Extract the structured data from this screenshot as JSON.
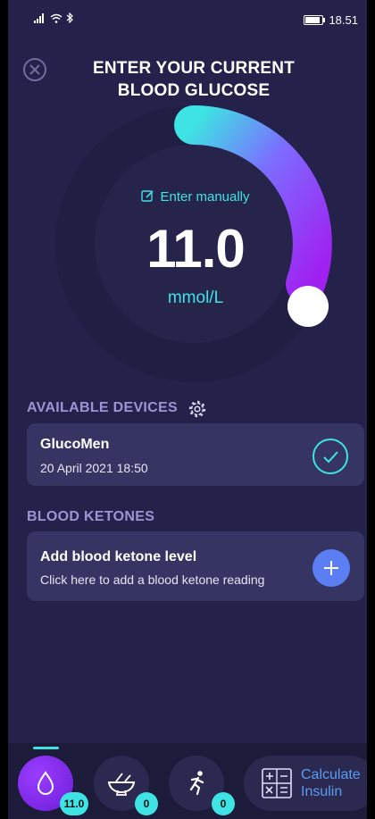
{
  "status_bar": {
    "time": "18.51"
  },
  "header": {
    "title_line1": "ENTER YOUR CURRENT",
    "title_line2": "BLOOD GLUCOSE"
  },
  "gauge": {
    "enter_manually_label": "Enter manually",
    "value": "11.0",
    "unit": "mmol/L"
  },
  "devices": {
    "section_label": "AVAILABLE DEVICES",
    "items": [
      {
        "name": "GlucoMen",
        "date": "20 April 2021 18:50"
      }
    ]
  },
  "ketones": {
    "section_label": "BLOOD KETONES",
    "title": "Add blood ketone level",
    "subtitle": "Click here to add a blood ketone reading"
  },
  "bottom_nav": {
    "glucose_badge": "11.0",
    "meal_badge": "0",
    "activity_badge": "0",
    "calculate_line1": "Calculate",
    "calculate_line2": "Insulin"
  },
  "colors": {
    "background": "#24224a",
    "accent_cyan": "#3ee3e3",
    "accent_purple": "#9b3cff",
    "card": "#363463",
    "plus_button": "#5b7ff2"
  },
  "icons": [
    "close-icon",
    "pencil-icon",
    "gear-icon",
    "check-icon",
    "plus-icon",
    "drop-icon",
    "bowl-icon",
    "runner-icon",
    "calculator-icon"
  ]
}
